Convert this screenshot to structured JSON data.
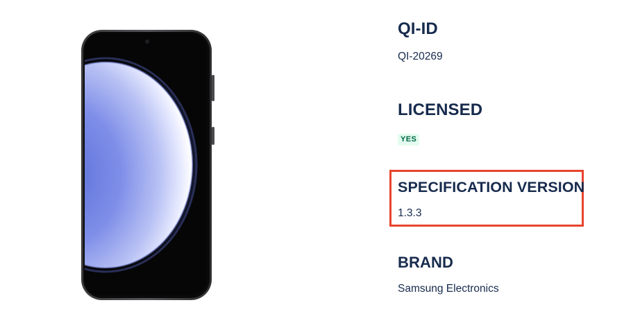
{
  "product_image": {
    "icon": "smartphone-image"
  },
  "fields": {
    "qi_id": {
      "title": "QI-ID",
      "value": "QI-20269"
    },
    "licensed": {
      "title": "LICENSED",
      "badge": "YES"
    },
    "specification_version": {
      "title": "SPECIFICATION VERSION",
      "value": "1.3.3"
    },
    "brand": {
      "title": "BRAND",
      "value": "Samsung Electronics"
    }
  },
  "colors": {
    "heading": "#172b4d",
    "badge_bg": "#e3fcef",
    "badge_text": "#006644",
    "highlight": "#e8442d"
  }
}
